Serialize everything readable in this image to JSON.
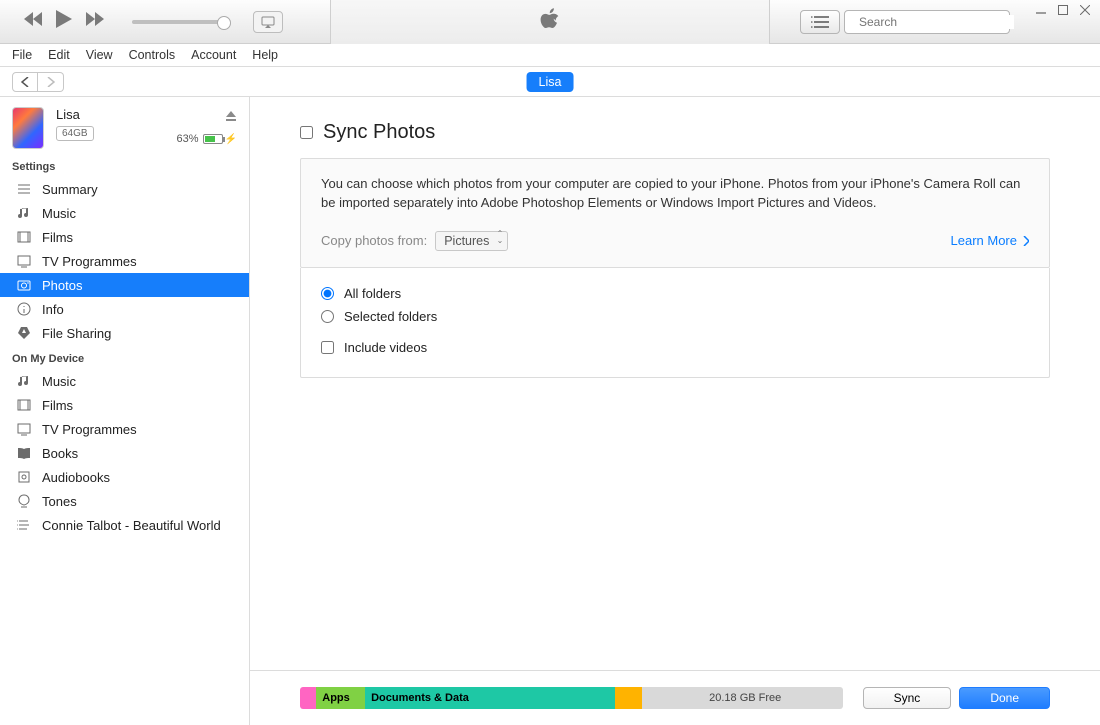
{
  "window": {
    "search_placeholder": "Search"
  },
  "menu": {
    "file": "File",
    "edit": "Edit",
    "view": "View",
    "controls": "Controls",
    "account": "Account",
    "help": "Help"
  },
  "device": {
    "name": "Lisa",
    "capacity_label": "64GB",
    "battery_text": "63%"
  },
  "sidebar": {
    "section_settings": "Settings",
    "settings": [
      "Summary",
      "Music",
      "Films",
      "TV Programmes",
      "Photos",
      "Info",
      "File Sharing"
    ],
    "section_device": "On My Device",
    "on_device": [
      "Music",
      "Films",
      "TV Programmes",
      "Books",
      "Audiobooks",
      "Tones",
      "Connie Talbot - Beautiful World"
    ]
  },
  "content": {
    "title": "Sync Photos",
    "description": "You can choose which photos from your computer are copied to your iPhone. Photos from your iPhone's Camera Roll can be imported separately into Adobe Photoshop Elements or Windows Import Pictures and Videos.",
    "copy_label": "Copy photos from:",
    "copy_value": "Pictures",
    "learn_more": "Learn More",
    "opt_all": "All folders",
    "opt_selected": "Selected folders",
    "opt_include": "Include videos"
  },
  "storage": {
    "segments": [
      {
        "label": "",
        "width": "3%",
        "color": "#ff65c2"
      },
      {
        "label": "Apps",
        "width": "9%",
        "color": "#80d144"
      },
      {
        "label": "Documents & Data",
        "width": "46%",
        "color": "#1ec8a5"
      },
      {
        "label": "",
        "width": "5%",
        "color": "#ffb300"
      },
      {
        "label": "20.18 GB Free",
        "width": "37%",
        "color": "#d9d9d9",
        "free": true
      }
    ],
    "sync_btn": "Sync",
    "done_btn": "Done"
  }
}
